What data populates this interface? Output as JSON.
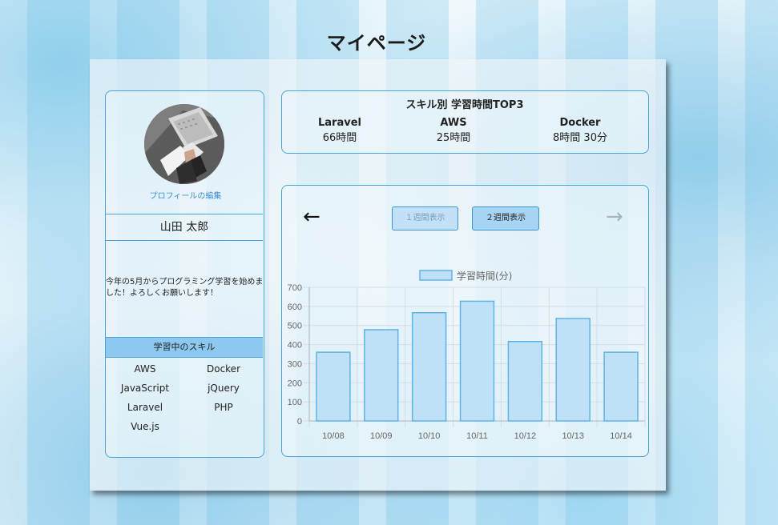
{
  "page": {
    "title": "マイページ"
  },
  "profile": {
    "edit_link": "プロフィールの編集",
    "name": "山田 太郎",
    "bio": "今年の5月からプログラミング学習を始めました！よろしくお願いします！",
    "skills_header": "学習中のスキル",
    "skills": [
      "AWS",
      "Docker",
      "JavaScript",
      "jQuery",
      "Laravel",
      "PHP",
      "Vue.js"
    ]
  },
  "top3": {
    "title": "スキル別 学習時間TOP3",
    "items": [
      {
        "name": "Laravel",
        "time": "66時間"
      },
      {
        "name": "AWS",
        "time": "25時間"
      },
      {
        "name": "Docker",
        "time": "8時間 30分"
      }
    ]
  },
  "chart_panel": {
    "prev_icon": "arrow-left-icon",
    "next_icon": "arrow-right-icon",
    "btn_1week": "１週間表示",
    "btn_2week": "２週間表示"
  },
  "chart_data": {
    "type": "bar",
    "series": [
      {
        "name": "学習時間(分)",
        "values": [
          360,
          478,
          567,
          627,
          416,
          537,
          360
        ]
      }
    ],
    "categories": [
      "10/08",
      "10/09",
      "10/10",
      "10/11",
      "10/12",
      "10/13",
      "10/14"
    ],
    "ylim": [
      0,
      700
    ],
    "yticks": [
      0,
      100,
      200,
      300,
      400,
      500,
      600,
      700
    ],
    "grid": true,
    "legend": "top",
    "colors": {
      "bar_fill": "#bfe1f7",
      "bar_stroke": "#5fb3e6",
      "grid": "#d6dde2"
    }
  }
}
